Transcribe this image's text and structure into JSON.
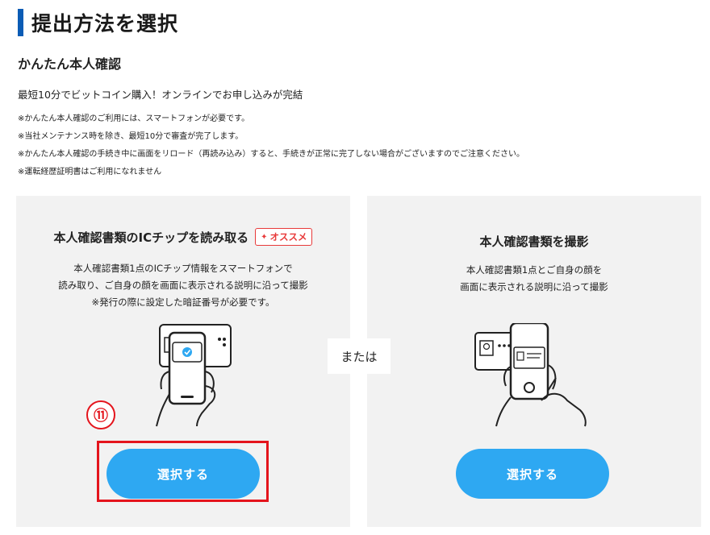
{
  "page": {
    "title": "提出方法を選択",
    "subtitle": "かんたん本人確認",
    "lead": "最短10分でビットコイン購入！オンラインでお申し込みが完結",
    "notes": [
      "※かんたん本人確認のご利用には、スマートフォンが必要です。",
      "※当社メンテナンス時を除き、最短10分で審査が完了します。",
      "※かんたん本人確認の手続き中に画面をリロード（再読み込み）すると、手続きが正常に完了しない場合がございますのでご注意ください。",
      "※運転経歴証明書はご利用になれません"
    ]
  },
  "options": {
    "ic_chip": {
      "title": "本人確認書類のICチップを読み取る",
      "badge": "オススメ",
      "description": [
        "本人確認書類1点のICチップ情報をスマートフォンで",
        "読み取り、ご自身の顔を画面に表示される説明に沿って撮影",
        "※発行の際に設定した暗証番号が必要です。"
      ],
      "button_label": "選択する"
    },
    "or_label": "または",
    "photo": {
      "title": "本人確認書類を撮影",
      "description": [
        "本人確認書類1点とご自身の顔を",
        "画面に表示される説明に沿って撮影"
      ],
      "button_label": "選択する"
    }
  },
  "annotation": {
    "step_number": "⑪"
  },
  "colors": {
    "accent_bar": "#0b5cb5",
    "button": "#2ea8f2",
    "highlight": "#e4141c",
    "badge": "#e83a3a",
    "card_bg": "#f2f2f2"
  }
}
